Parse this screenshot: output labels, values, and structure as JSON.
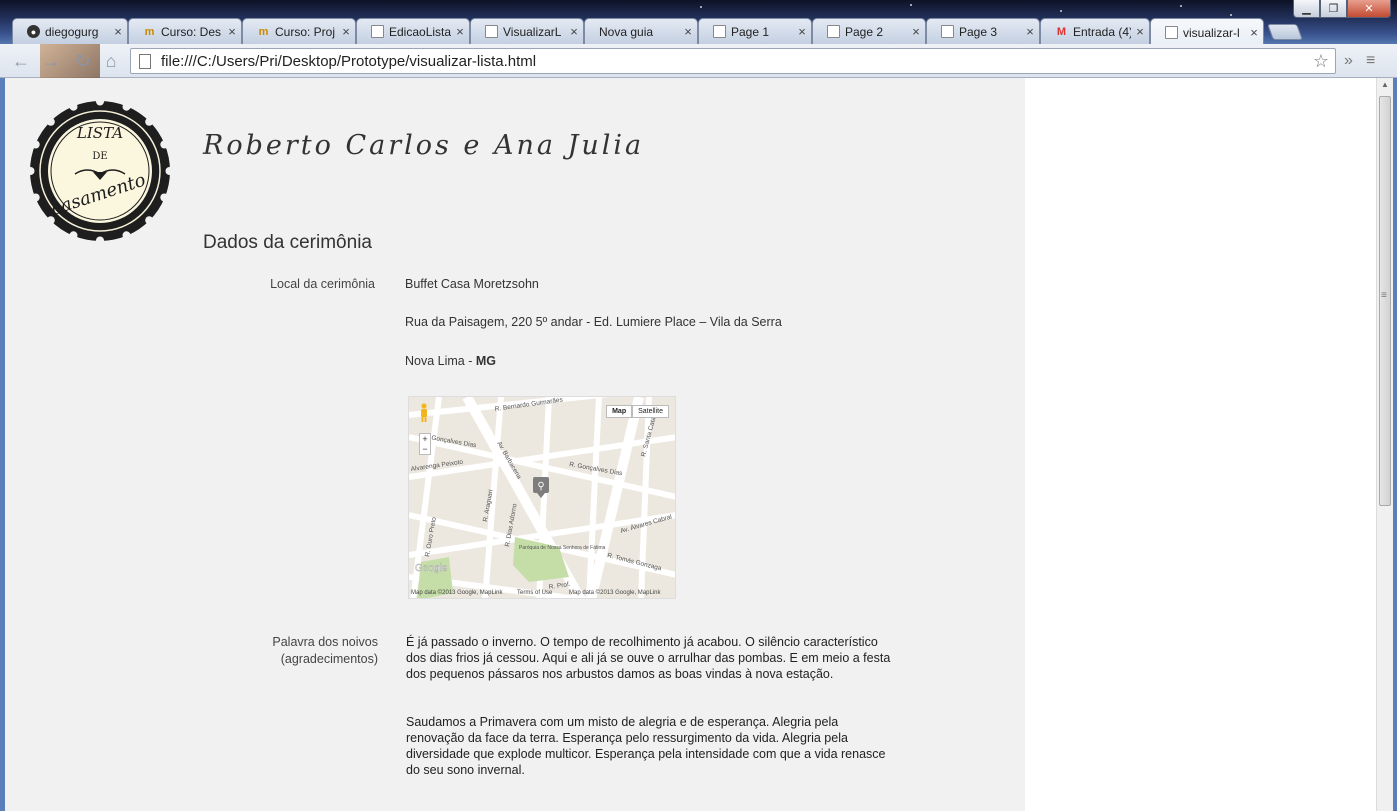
{
  "browser": {
    "tabs": [
      {
        "title": "diegogurg",
        "icon": "github-icon"
      },
      {
        "title": "Curso: Des",
        "icon": "moodle-icon"
      },
      {
        "title": "Curso: Proj",
        "icon": "moodle-icon"
      },
      {
        "title": "EdicaoLista",
        "icon": "document-icon"
      },
      {
        "title": "VisualizarL",
        "icon": "document-icon"
      },
      {
        "title": "Nova guia",
        "icon": "none"
      },
      {
        "title": "Page 1",
        "icon": "document-icon"
      },
      {
        "title": "Page 2",
        "icon": "document-icon"
      },
      {
        "title": "Page 3",
        "icon": "document-icon"
      },
      {
        "title": "Entrada (4)",
        "icon": "gmail-icon"
      },
      {
        "title": "visualizar-l",
        "icon": "document-icon",
        "active": true
      }
    ],
    "url": "file:///C:/Users/Pri/Desktop/Prototype/visualizar-lista.html"
  },
  "page": {
    "logo": {
      "line1": "LISTA",
      "line2": "DE",
      "line3": "casamento"
    },
    "couple_names": "Roberto Carlos e Ana Julia",
    "section_title": "Dados da cerimônia",
    "ceremony": {
      "label": "Local da cerimônia",
      "venue": "Buffet Casa Moretzsohn",
      "address": "Rua da Paisagem, 220 5º andar - Ed. Lumiere Place – Vila da Serra",
      "city": "Nova Lima - ",
      "state": "MG"
    },
    "map": {
      "btn_map": "Map",
      "btn_satellite": "Satellite",
      "zoom_in": "+",
      "zoom_out": "−",
      "streets": [
        "R. Bernardo Guimarães",
        "R. Gonçalves Dias",
        "R. Gonçalves Dias",
        "Alvarenga Peixoto",
        "Av. Barbacena",
        "R. Santa Catarina",
        "Av. Álvares Cabral",
        "R. Tomás Gonzaga",
        "R. Ouro Preto",
        "R. Araguari",
        "R. Dias Adorno",
        "R. Prof.",
        "Paróquia de Nossa Senhora de Fátima"
      ],
      "google": "Google",
      "foot1": "Map data ©2013 Google, MapLink",
      "terms": "Terms of Use",
      "foot2": "Map data ©2013 Google, MapLink"
    },
    "words": {
      "label_line1": "Palavra dos noivos",
      "label_line2": "(agradecimentos)",
      "paragraph1": "É já passado o inverno. O tempo de recolhimento já acabou. O silêncio característico dos dias frios já cessou. Aqui e ali já se ouve o arrulhar das pombas. E em meio a festa dos pequenos pássaros nos arbustos damos as boas vindas à nova estação.",
      "paragraph2": "Saudamos a Primavera com um misto de alegria e de esperança. Alegria pela renovação da face da terra. Esperança pelo ressurgimento da vida. Alegria pela diversidade que explode multicor. Esperança pela intensidade com que a vida renasce do seu sono invernal."
    }
  }
}
